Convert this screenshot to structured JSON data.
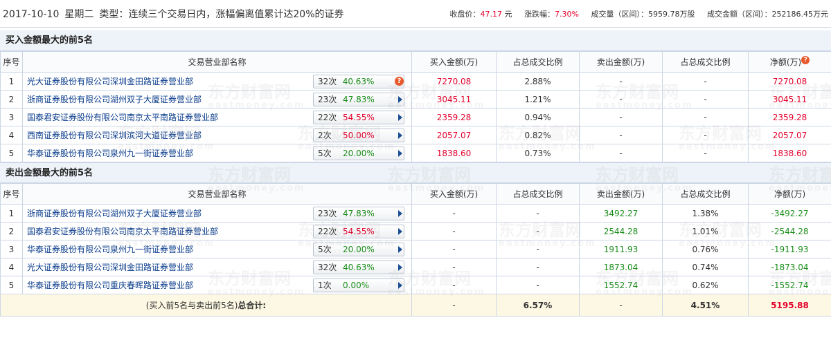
{
  "header": {
    "date": "2017-10-10",
    "weekday": "星期二",
    "type_label": "类型：连续三个交易日内，涨幅偏离值累计达20%的证券",
    "close_label": "收盘价：",
    "close_value": "47.17",
    "close_unit": "元",
    "change_label": "涨跌幅：",
    "change_value": "7.30%",
    "volume_label": "成交量（区间）：",
    "volume_value": "5959.78万股",
    "amount_label": "成交金额（区间）：",
    "amount_value": "252186.45万元"
  },
  "columns": {
    "seq": "序号",
    "dept": "交易营业部名称",
    "buy": "买入金额(万)",
    "buy_ratio": "占总成交比例",
    "sell": "卖出金额(万)",
    "sell_ratio": "占总成交比例",
    "net": "净额(万)"
  },
  "buy_section": {
    "title": "买入金额最大的前5名",
    "rows": [
      {
        "seq": "1",
        "name": "光大证券股份有限公司深圳金田路证券营业部",
        "count": "32次",
        "pct": "40.63%",
        "pct_color": "green",
        "icon": "question",
        "buy": "7270.08",
        "buy_ratio": "2.88%",
        "sell": "-",
        "sell_ratio": "-",
        "net": "7270.08"
      },
      {
        "seq": "2",
        "name": "浙商证券股份有限公司湖州双子大厦证券营业部",
        "count": "23次",
        "pct": "47.83%",
        "pct_color": "green",
        "icon": "arrow",
        "buy": "3045.11",
        "buy_ratio": "1.21%",
        "sell": "-",
        "sell_ratio": "-",
        "net": "3045.11"
      },
      {
        "seq": "3",
        "name": "国泰君安证券股份有限公司南京太平南路证券营业部",
        "count": "22次",
        "pct": "54.55%",
        "pct_color": "red",
        "icon": "arrow",
        "buy": "2359.28",
        "buy_ratio": "0.94%",
        "sell": "-",
        "sell_ratio": "-",
        "net": "2359.28"
      },
      {
        "seq": "4",
        "name": "西南证券股份有限公司深圳滨河大道证券营业部",
        "count": "2次",
        "pct": "50.00%",
        "pct_color": "red",
        "icon": "arrow",
        "buy": "2057.07",
        "buy_ratio": "0.82%",
        "sell": "-",
        "sell_ratio": "-",
        "net": "2057.07"
      },
      {
        "seq": "5",
        "name": "华泰证券股份有限公司泉州九一街证券营业部",
        "count": "5次",
        "pct": "20.00%",
        "pct_color": "green",
        "icon": "arrow",
        "buy": "1838.60",
        "buy_ratio": "0.73%",
        "sell": "-",
        "sell_ratio": "-",
        "net": "1838.60"
      }
    ]
  },
  "sell_section": {
    "title": "卖出金额最大的前5名",
    "rows": [
      {
        "seq": "1",
        "name": "浙商证券股份有限公司湖州双子大厦证券营业部",
        "count": "23次",
        "pct": "47.83%",
        "pct_color": "green",
        "icon": "arrow",
        "buy": "-",
        "buy_ratio": "-",
        "sell": "3492.27",
        "sell_ratio": "1.38%",
        "net": "-3492.27"
      },
      {
        "seq": "2",
        "name": "国泰君安证券股份有限公司南京太平南路证券营业部",
        "count": "22次",
        "pct": "54.55%",
        "pct_color": "red",
        "icon": "arrow",
        "buy": "-",
        "buy_ratio": "-",
        "sell": "2544.28",
        "sell_ratio": "1.01%",
        "net": "-2544.28"
      },
      {
        "seq": "3",
        "name": "华泰证券股份有限公司泉州九一街证券营业部",
        "count": "5次",
        "pct": "20.00%",
        "pct_color": "green",
        "icon": "arrow",
        "buy": "-",
        "buy_ratio": "-",
        "sell": "1911.93",
        "sell_ratio": "0.76%",
        "net": "-1911.93"
      },
      {
        "seq": "4",
        "name": "光大证券股份有限公司深圳金田路证券营业部",
        "count": "32次",
        "pct": "40.63%",
        "pct_color": "green",
        "icon": "arrow",
        "buy": "-",
        "buy_ratio": "-",
        "sell": "1873.04",
        "sell_ratio": "0.74%",
        "net": "-1873.04"
      },
      {
        "seq": "5",
        "name": "华泰证券股份有限公司重庆春晖路证券营业部",
        "count": "1次",
        "pct": "0.00%",
        "pct_color": "green",
        "icon": "arrow",
        "buy": "-",
        "buy_ratio": "-",
        "sell": "1552.74",
        "sell_ratio": "0.62%",
        "net": "-1552.74"
      }
    ]
  },
  "total": {
    "label_prefix": "(买入前5名与卖出前5名)",
    "label_bold": "总合计:",
    "buy": "-",
    "buy_ratio": "6.57%",
    "sell": "-",
    "sell_ratio": "4.51%",
    "net": "5195.88"
  },
  "watermark": {
    "text": "东方财富网",
    "sub": "eastmoney.com"
  },
  "colors": {
    "red": "#e4002b",
    "green": "#198d19",
    "link": "#0a3c8c"
  }
}
